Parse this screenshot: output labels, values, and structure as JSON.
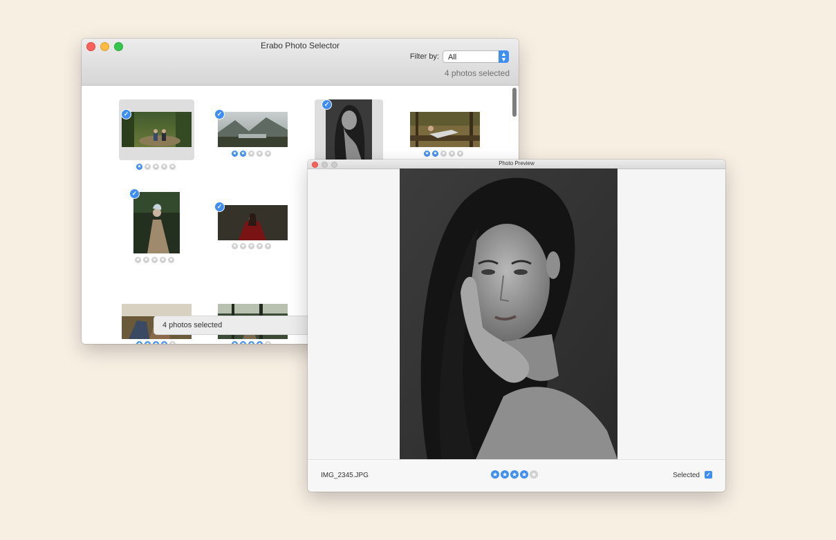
{
  "main_window": {
    "title": "Erabo Photo Selector",
    "filter_label": "Filter by:",
    "filter_value": "All",
    "selected_count": "4 photos selected",
    "toast": "4 photos selected",
    "accent": "#3e8ef7",
    "thumbnails": [
      {
        "id": "forest-family",
        "selected": true,
        "highlighted": true,
        "rating": 1
      },
      {
        "id": "lake-landscape",
        "selected": true,
        "highlighted": false,
        "rating": 2
      },
      {
        "id": "bw-portrait",
        "selected": true,
        "highlighted": true,
        "rating": null
      },
      {
        "id": "woman-on-log",
        "selected": false,
        "highlighted": false,
        "rating": 2
      },
      {
        "id": "woman-in-dress",
        "selected": true,
        "highlighted": false,
        "rating": 0
      },
      {
        "id": "woman-red-wings",
        "selected": true,
        "highlighted": false,
        "rating": 0
      },
      {
        "id": "couple-outdoors",
        "selected": false,
        "highlighted": false,
        "rating": 4
      },
      {
        "id": "forest-path",
        "selected": false,
        "highlighted": false,
        "rating": 4
      }
    ]
  },
  "preview_window": {
    "title": "Photo Preview",
    "filename": "IMG_2345.JPG",
    "rating": 4,
    "max_rating": 5,
    "selected_label": "Selected",
    "selected": true
  }
}
